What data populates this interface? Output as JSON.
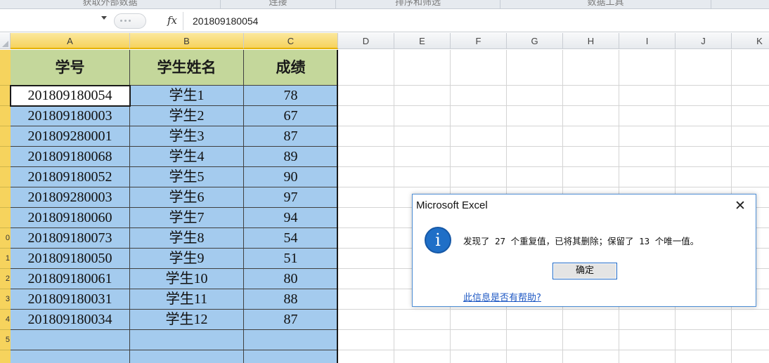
{
  "ribbon": {
    "groups": [
      "获取外部数据",
      "连接",
      "排序和筛选",
      "数据工具"
    ]
  },
  "formula_bar": {
    "name_box": "",
    "fx_label": "fx",
    "value": "201809180054"
  },
  "sheet": {
    "columns": [
      "A",
      "B",
      "C",
      "D",
      "E",
      "F",
      "G",
      "H",
      "I",
      "J",
      "K"
    ],
    "selected_columns": [
      "A",
      "B",
      "C"
    ],
    "row_labels": [
      "",
      "",
      "",
      "",
      "",
      "",
      "",
      "",
      "0",
      "1",
      "2",
      "3",
      "4",
      "5"
    ],
    "headers": [
      "学号",
      "学生姓名",
      "成绩"
    ],
    "rows": [
      [
        "201809180054",
        "学生1",
        "78"
      ],
      [
        "201809180003",
        "学生2",
        "67"
      ],
      [
        "201809280001",
        "学生3",
        "87"
      ],
      [
        "201809180068",
        "学生4",
        "89"
      ],
      [
        "201809180052",
        "学生5",
        "90"
      ],
      [
        "201809280003",
        "学生6",
        "97"
      ],
      [
        "201809180060",
        "学生7",
        "94"
      ],
      [
        "201809180073",
        "学生8",
        "54"
      ],
      [
        "201809180050",
        "学生9",
        "51"
      ],
      [
        "201809180061",
        "学生10",
        "80"
      ],
      [
        "201809180031",
        "学生11",
        "88"
      ],
      [
        "201809180034",
        "学生12",
        "87"
      ],
      [
        "",
        "",
        ""
      ],
      [
        "",
        "",
        ""
      ]
    ],
    "colors": {
      "header_fill": "#c4d79b",
      "data_fill": "#a4cbee",
      "selected_header": "#f6d35d"
    }
  },
  "dialog": {
    "title": "Microsoft Excel",
    "close_glyph": "✕",
    "icon": "info-icon",
    "icon_glyph": "i",
    "message": "发现了 27 个重复值，已将其删除；保留了 13 个唯一值。",
    "ok_label": "确定",
    "help_link": "此信息是否有帮助?"
  }
}
